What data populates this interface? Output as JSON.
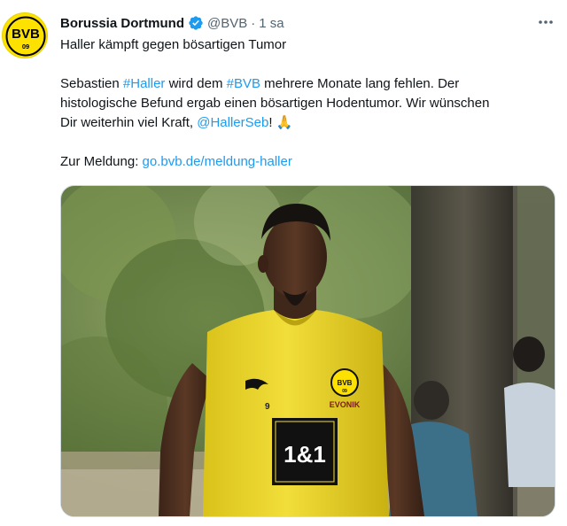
{
  "tweet": {
    "author": {
      "display_name": "Borussia Dortmund",
      "handle": "@BVB",
      "avatar_text_top": "BVB",
      "avatar_text_bottom": "09",
      "verified_icon": "verified-badge-icon"
    },
    "separator": "·",
    "time": "1 sa",
    "more_icon": "more-horizontal-icon",
    "title_line": "Haller kämpft gegen bösartigen Tumor",
    "paragraph": {
      "l1_a": "Sebastien ",
      "l1_hashtag1": "#Haller",
      "l1_b": " wird dem ",
      "l1_hashtag2": "#BVB",
      "l1_c": " mehrere Monate lang fehlen. Der",
      "l2": "histologische Befund ergab einen bösartigen Hodentumor. Wir wünschen",
      "l3_a": "Dir weiterhin viel Kraft, ",
      "l3_mention": "@HallerSeb",
      "l3_b": "! ",
      "l3_emoji": "🙏"
    },
    "link_line": {
      "label": "Zur Meldung: ",
      "url": "go.bvb.de/meldung-haller"
    },
    "media": {
      "jersey_sponsor": "1&1",
      "jersey_brand": "EVONIK",
      "jersey_number": "9",
      "crest_text": "BVB",
      "crest_year": "09"
    }
  },
  "colors": {
    "link": "#1d9bf0",
    "bvb_yellow": "#fde100",
    "text": "#0f1419",
    "muted": "#536471"
  }
}
